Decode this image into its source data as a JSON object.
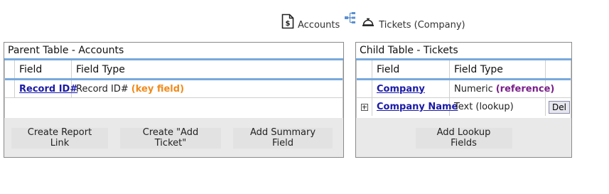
{
  "header": {
    "parent_label": "Accounts",
    "child_label": "Tickets (Company)",
    "parent_icon": "dollar-document-icon",
    "relationship_icon": "relationship-tree-icon",
    "child_icon": "service-bell-icon"
  },
  "parent_panel": {
    "title": "Parent Table - Accounts",
    "columns": [
      "Field",
      "Field Type"
    ],
    "rows": [
      {
        "field": "Record ID#",
        "type": "Record ID#",
        "note": "(key field)"
      }
    ],
    "buttons": {
      "create_report_link": "Create Report Link",
      "create_add_ticket": "Create \"Add Ticket\"",
      "add_summary_field": "Add Summary Field"
    }
  },
  "child_panel": {
    "title": "Child Table - Tickets",
    "columns": [
      "Field",
      "Field Type",
      ""
    ],
    "rows": [
      {
        "field": "Company",
        "type": "Numeric",
        "note": "(reference)"
      },
      {
        "field": "Company Name",
        "type": "Text (lookup)",
        "action": "Del"
      }
    ],
    "buttons": {
      "add_lookup_fields": "Add Lookup Fields"
    }
  },
  "colors": {
    "accent_blue": "#78a9dc",
    "link": "#1a1aa6",
    "key_field": "#f08b1c",
    "reference": "#7a1f8a"
  }
}
